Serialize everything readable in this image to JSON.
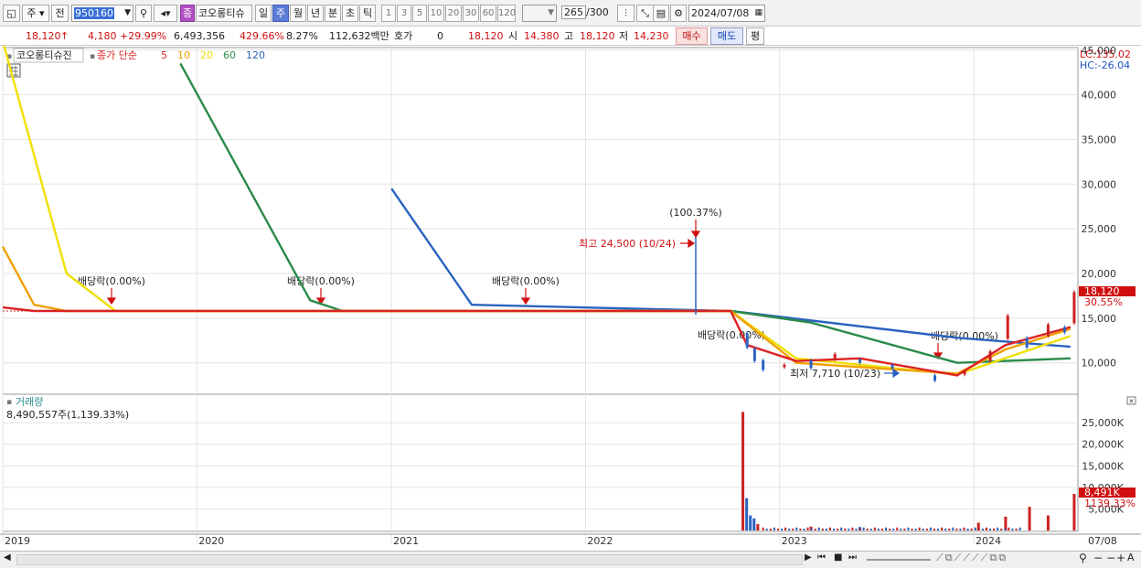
{
  "toolbar": {
    "period_select": "주",
    "prev_label": "전",
    "code": "950160",
    "stock_badge": "종",
    "name": "코오롱티슈",
    "interval_tabs": [
      "일",
      "주",
      "월",
      "년",
      "분",
      "초",
      "틱"
    ],
    "selected_tab": "주",
    "tick_buttons": [
      "1",
      "3",
      "5",
      "10",
      "20",
      "30",
      "60",
      "120"
    ],
    "count": "265",
    "count_total": "/300",
    "date": "2024/07/08"
  },
  "quote": {
    "price": "18,120",
    "arrow": "↑",
    "change": "4,180",
    "change_pct": "+29.99%",
    "volume": "6,493,356",
    "volume_pct": "429.66%",
    "turnover": "8.27%",
    "amount": "112,632백만",
    "hoga_label": "호가",
    "hoga_value": "0",
    "ask": "18,120",
    "open_label": "시",
    "open": "14,380",
    "high_label": "고",
    "high": "18,120",
    "low_label": "저",
    "low": "14,230",
    "buy_button": "매수",
    "sell_button": "매도",
    "eval_button": "평"
  },
  "legend": {
    "stock_name": "코오롱티슈진",
    "ma_label": "종가 단순",
    "ma_periods": [
      "5",
      "10",
      "20",
      "60",
      "120"
    ],
    "ma_colors": [
      "#dd2222",
      "#f0a000",
      "#f0e000",
      "#2a8a4a",
      "#2a62c0"
    ]
  },
  "lc_hc": {
    "lc": "LC:135.02",
    "hc": "HC:-26.04"
  },
  "price_axis": [
    "45,000",
    "40,000",
    "35,000",
    "30,000",
    "25,000",
    "20,000",
    "15,000",
    "10,000"
  ],
  "price_tag": {
    "value": "18,120",
    "pct": "30.55%"
  },
  "volume_axis": [
    "25,000K",
    "20,000K",
    "15,000K",
    "10,000K",
    "5,000K"
  ],
  "volume_tag": {
    "value": "8,491K",
    "pct": "1139.33%"
  },
  "volume_panel": {
    "title": "거래량",
    "value": "8,490,557주(1,139.33%)"
  },
  "x_axis": [
    "2019",
    "2020",
    "2021",
    "2022",
    "2023",
    "2024",
    "07/08"
  ],
  "annotations": {
    "dividend1": "배당락(0.00%)",
    "dividend2": "배당락(0.00%)",
    "dividend3": "배당락(0.00%)",
    "dividend4": "배당락(0.00%)",
    "dividend5": "배당락(0.00%)",
    "spike": "(100.37%)",
    "high": "최고 24,500 (10/24)",
    "low": "최저 7,710 (10/23)"
  },
  "chart_data": {
    "type": "line",
    "title": "코오롱티슈진",
    "x_range": [
      "2019",
      "2024-07-08"
    ],
    "ylim": [
      7000,
      46000
    ],
    "series": [
      {
        "name": "5",
        "color": "#dd2222",
        "points": [
          [
            "2019-01",
            16200
          ],
          [
            "2019-03",
            15800
          ],
          [
            "2022-10",
            15800
          ],
          [
            "2022-11",
            12000
          ],
          [
            "2023-02",
            10200
          ],
          [
            "2023-06",
            10500
          ],
          [
            "2023-12",
            8600
          ],
          [
            "2024-03",
            12000
          ],
          [
            "2024-07",
            14000
          ]
        ]
      },
      {
        "name": "10",
        "color": "#f0a000",
        "points": [
          [
            "2019-01",
            23000
          ],
          [
            "2019-03",
            16500
          ],
          [
            "2019-05",
            15800
          ],
          [
            "2022-10",
            15800
          ],
          [
            "2023-02",
            10000
          ],
          [
            "2023-12",
            8800
          ],
          [
            "2024-03",
            11500
          ],
          [
            "2024-07",
            13800
          ]
        ]
      },
      {
        "name": "20",
        "color": "#f0e000",
        "points": [
          [
            "2019-01",
            46000
          ],
          [
            "2019-05",
            20000
          ],
          [
            "2019-08",
            15800
          ],
          [
            "2022-10",
            15800
          ],
          [
            "2023-02",
            10500
          ],
          [
            "2023-12",
            8700
          ],
          [
            "2024-07",
            13000
          ]
        ]
      },
      {
        "name": "60",
        "color": "#2a8a4a",
        "points": [
          [
            "2019-12",
            43500
          ],
          [
            "2020-08",
            17000
          ],
          [
            "2020-10",
            15800
          ],
          [
            "2022-10",
            15800
          ],
          [
            "2023-03",
            14500
          ],
          [
            "2023-12",
            10000
          ],
          [
            "2024-07",
            10500
          ]
        ]
      },
      {
        "name": "120",
        "color": "#2a62c0",
        "points": [
          [
            "2021-01",
            29500
          ],
          [
            "2021-06",
            16500
          ],
          [
            "2022-10",
            15800
          ],
          [
            "2023-12",
            12800
          ],
          [
            "2024-07",
            11800
          ]
        ]
      }
    ],
    "volume_bars": [
      {
        "x": "2022-10-24",
        "value": 27500,
        "color": "#cc2222"
      },
      {
        "x": "2022-10-31",
        "value": 7500,
        "color": "#2a62c0"
      },
      {
        "x": "2022-11-07",
        "value": 3500,
        "color": "#2a62c0"
      },
      {
        "x": "2022-11-14",
        "value": 2800,
        "color": "#2a62c0"
      },
      {
        "x": "2022-11-21",
        "value": 1500,
        "color": "#cc2222"
      },
      {
        "x": "2023-03-01",
        "value": 900,
        "color": "#cc2222"
      },
      {
        "x": "2023-06-01",
        "value": 800,
        "color": "#2a62c0"
      },
      {
        "x": "2024-01-10",
        "value": 1800,
        "color": "#cc2222"
      },
      {
        "x": "2024-03-01",
        "value": 3200,
        "color": "#cc2222"
      },
      {
        "x": "2024-04-15",
        "value": 5500,
        "color": "#cc2222"
      },
      {
        "x": "2024-05-20",
        "value": 3500,
        "color": "#cc2222"
      },
      {
        "x": "2024-07-08",
        "value": 8491,
        "color": "#cc2222"
      }
    ],
    "volume_ylim": [
      0,
      28000
    ]
  }
}
